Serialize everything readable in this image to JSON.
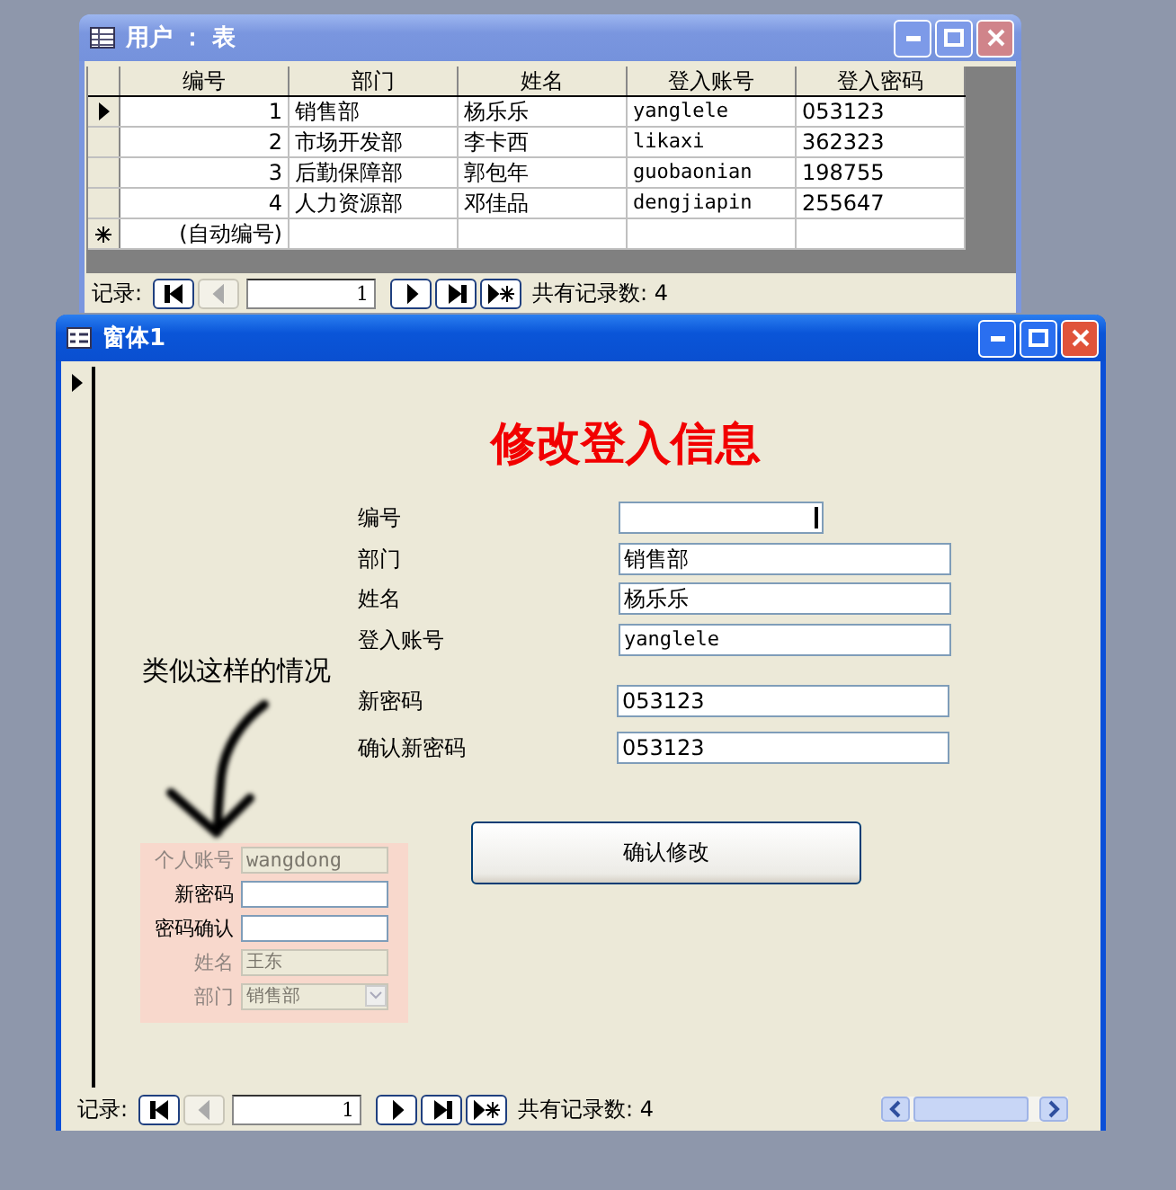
{
  "table_window": {
    "title": "用户 ： 表",
    "columns": [
      "编号",
      "部门",
      "姓名",
      "登入账号",
      "登入密码"
    ],
    "rows": [
      {
        "selected": true,
        "cells": [
          "1",
          "销售部",
          "杨乐乐",
          "yanglele",
          "053123"
        ]
      },
      {
        "selected": false,
        "cells": [
          "2",
          "市场开发部",
          "李卡西",
          "likaxi",
          "362323"
        ]
      },
      {
        "selected": false,
        "cells": [
          "3",
          "后勤保障部",
          "郭包年",
          "guobaonian",
          "198755"
        ]
      },
      {
        "selected": false,
        "cells": [
          "4",
          "人力资源部",
          "邓佳品",
          "dengjiapin",
          "255647"
        ]
      }
    ],
    "new_row": {
      "cells": [
        "(自动编号)",
        "",
        "",
        "",
        ""
      ]
    },
    "navigation": {
      "label": "记录:",
      "record": "1",
      "count": "共有记录数: 4",
      "buttons": [
        {
          "kind": "first",
          "disabled": false
        },
        {
          "kind": "prev",
          "disabled": true
        },
        {
          "kind": "next",
          "disabled": false
        },
        {
          "kind": "last",
          "disabled": false
        },
        {
          "kind": "new",
          "disabled": false
        }
      ]
    }
  },
  "form_window": {
    "title": "窗体1",
    "heading": "修改登入信息",
    "fields": [
      {
        "label": "编号",
        "kind": "short"
      },
      {
        "label": "部门",
        "value": "销售部",
        "kind": "wide"
      },
      {
        "label": "姓名",
        "value": "杨乐乐",
        "kind": "wide"
      },
      {
        "label": "登入账号",
        "value": "yanglele",
        "kind": "wide"
      },
      {
        "label": "新密码",
        "value": "053123",
        "kind": "wide"
      },
      {
        "label": "确认新密码",
        "value": "053123",
        "kind": "wide"
      }
    ],
    "button": "确认修改",
    "annotation": "类似这样的情况",
    "example_panel": {
      "rows": [
        {
          "label": "个人账号",
          "value": "wangdong",
          "kind": "text",
          "disabled": true
        },
        {
          "label": "新密码",
          "kind": "text",
          "disabled": false
        },
        {
          "label": "密码确认",
          "kind": "text",
          "disabled": false
        },
        {
          "label": "姓名",
          "value": "王东",
          "kind": "text",
          "disabled": true
        },
        {
          "label": "部门",
          "value": "销售部",
          "kind": "select",
          "disabled": true
        }
      ]
    },
    "navigation": {
      "label": "记录:",
      "record": "1",
      "count": "共有记录数: 4",
      "buttons": [
        {
          "kind": "first",
          "disabled": false
        },
        {
          "kind": "prev",
          "disabled": true
        },
        {
          "kind": "next",
          "disabled": false
        },
        {
          "kind": "last",
          "disabled": false
        },
        {
          "kind": "new",
          "disabled": false
        }
      ]
    }
  }
}
